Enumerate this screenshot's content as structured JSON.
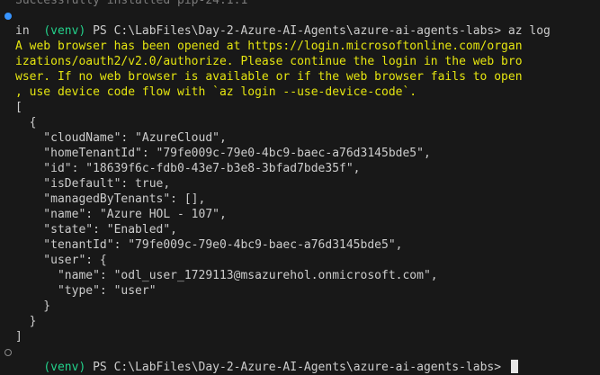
{
  "terminal": {
    "clipped_top_line": "Successfully installed pip-24.1.1",
    "command_prompt": {
      "venv": "(venv)",
      "path": " PS C:\\LabFiles\\Day-2-Azure-AI-Agents\\azure-ai-agents-labs> az log",
      "wrap": "in"
    },
    "browser_message": [
      "A web browser has been opened at https://login.microsoftonline.com/organ",
      "izations/oauth2/v2.0/authorize. Please continue the login in the web bro",
      "wser. If no web browser is available or if the web browser fails to open",
      ", use device code flow with `az login --use-device-code`."
    ],
    "json_output": [
      "[",
      "  {",
      "    \"cloudName\": \"AzureCloud\",",
      "    \"homeTenantId\": \"79fe009c-79e0-4bc9-baec-a76d3145bde5\",",
      "    \"id\": \"18639f6c-fdb0-43e7-b3e8-3bfad7bde35f\",",
      "    \"isDefault\": true,",
      "    \"managedByTenants\": [],",
      "    \"name\": \"Azure HOL - 107\",",
      "    \"state\": \"Enabled\",",
      "    \"tenantId\": \"79fe009c-79e0-4bc9-baec-a76d3145bde5\",",
      "    \"user\": {",
      "      \"name\": \"odl_user_1729113@msazurehol.onmicrosoft.com\",",
      "      \"type\": \"user\"",
      "    }",
      "  }",
      "]"
    ],
    "final_prompt": {
      "venv": "(venv)",
      "path": " PS C:\\LabFiles\\Day-2-Azure-AI-Agents\\azure-ai-agents-labs> "
    }
  },
  "colors": {
    "background": "#181818",
    "text": "#cccccc",
    "venv": "#23d18b",
    "warning": "#e5e510",
    "marker_active": "#3794ff"
  }
}
